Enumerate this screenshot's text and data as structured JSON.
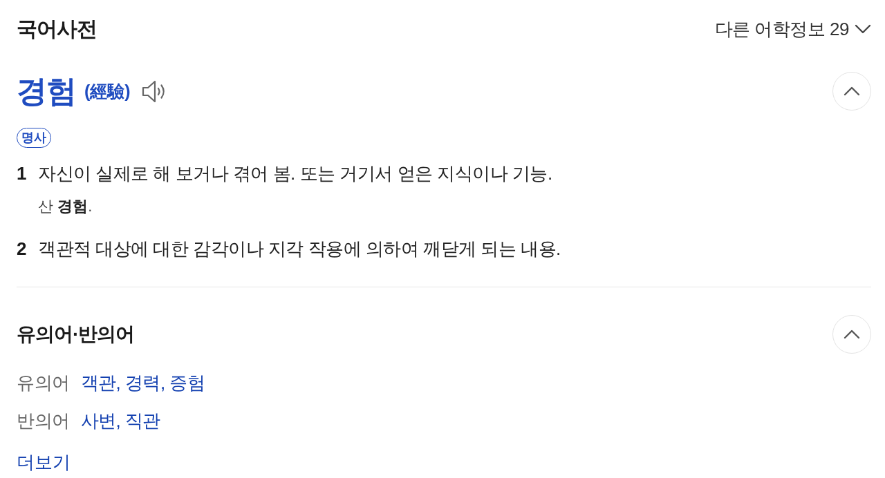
{
  "header": {
    "title": "국어사전",
    "other_info": {
      "label": "다른 어학정보",
      "count": "29",
      "expanded": false
    }
  },
  "entry": {
    "headword": "경험",
    "hanja": "(經驗)",
    "expanded": true,
    "part_of_speech": "명사",
    "senses": [
      {
        "number": "1",
        "definition": "자신이 실제로 해 보거나 겪어 봄. 또는 거기서 얻은 지식이나 기능.",
        "example": "산 **경험**."
      },
      {
        "number": "2",
        "definition": "객관적 대상에 대한 감각이나 지각 작용에 의하여 깨닫게 되는 내용."
      }
    ]
  },
  "related": {
    "title": "유의어·반의어",
    "expanded": true,
    "groups": [
      {
        "label": "유의어",
        "words": "객관, 경력, 증험"
      },
      {
        "label": "반의어",
        "words": "사변, 직관"
      }
    ],
    "more": "더보기"
  }
}
